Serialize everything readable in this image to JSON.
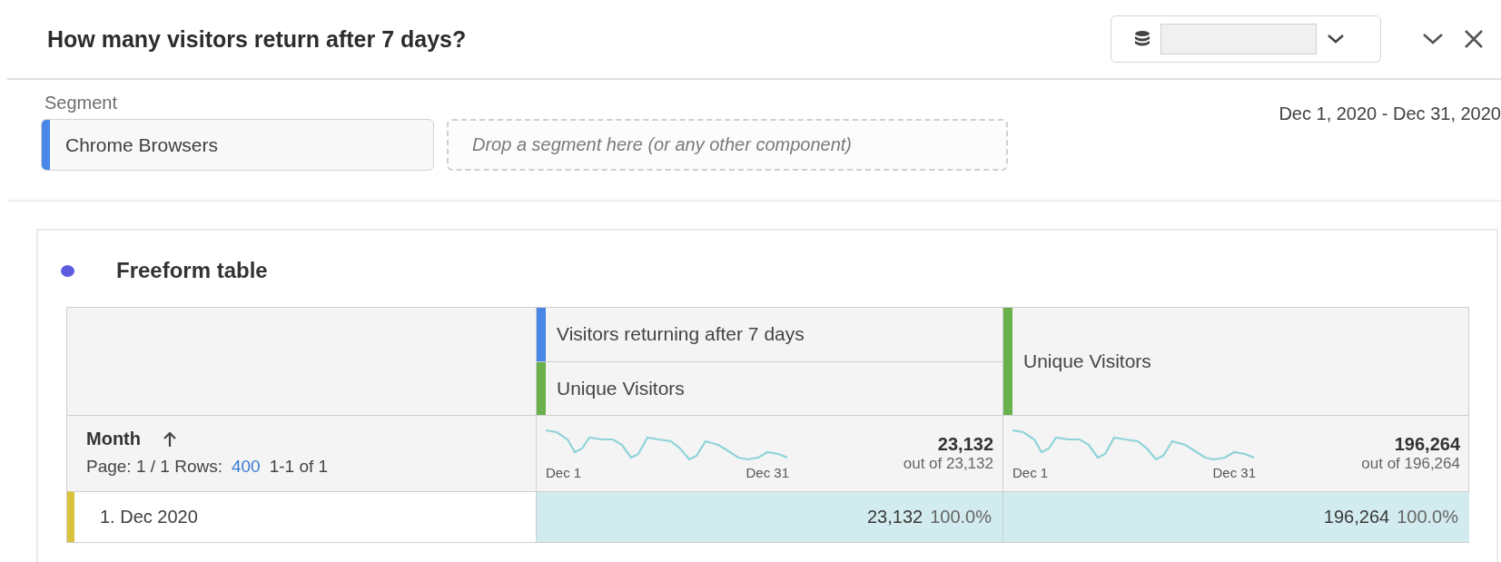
{
  "header": {
    "title": "How many visitors return after 7 days?"
  },
  "segment_bar": {
    "label": "Segment",
    "segments": [
      {
        "name": "Chrome Browsers",
        "color": "#4a86e8"
      }
    ],
    "drop_hint": "Drop a segment here (or any other component)",
    "date_range": "Dec 1, 2020 - Dec 31, 2020"
  },
  "panel": {
    "title": "Freeform table",
    "table": {
      "dimension": {
        "name": "Month",
        "pagination": "Page: 1 / 1 Rows:",
        "rows_per_page": "400",
        "range": "1-1 of 1"
      },
      "metric_columns": [
        {
          "headers": [
            {
              "name": "Visitors returning after 7 days",
              "color": "#4a86e8"
            },
            {
              "name": "Unique Visitors",
              "color": "#6ab04c"
            }
          ],
          "total": "23,132",
          "total_note": "out of 23,132",
          "spark_start": "Dec 1",
          "spark_end": "Dec 31"
        },
        {
          "headers": [
            {
              "name": "Unique Visitors",
              "color": "#6ab04c"
            }
          ],
          "total": "196,264",
          "total_note": "out of 196,264",
          "spark_start": "Dec 1",
          "spark_end": "Dec 31"
        }
      ],
      "rows": [
        {
          "label": "1. Dec 2020",
          "cells": [
            {
              "value": "23,132",
              "percent": "100.0%"
            },
            {
              "value": "196,264",
              "percent": "100.0%"
            }
          ]
        }
      ]
    }
  }
}
